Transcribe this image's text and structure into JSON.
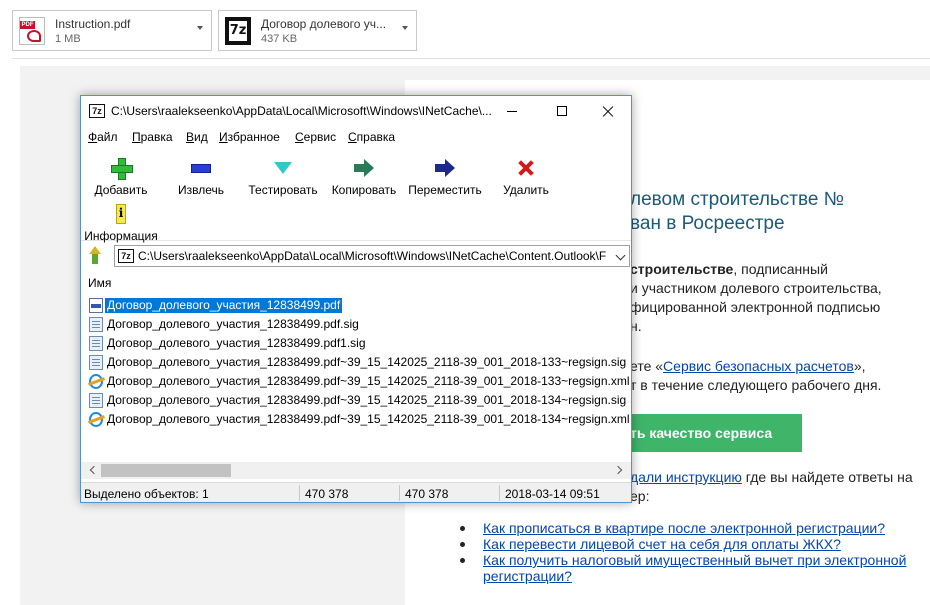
{
  "attachments": [
    {
      "name": "Instruction.pdf",
      "size": "1 MB"
    },
    {
      "name": "Договор долевого уч...",
      "size": "437 KB"
    }
  ],
  "email": {
    "title_line1": "левом строительстве №",
    "title_line2": "ван в Росреестре",
    "para1_bold": "строительстве",
    "para1_line1_rest": ", подписанный",
    "para1_line2": "и участником долевого строительства,",
    "para1_line3": "фицированной электронной подписью",
    "para1_line4": "н.",
    "para2_line1_pre": "ете «",
    "para2_link": "Сервис безопасных расчетов",
    "para2_line1_post": "»,",
    "para2_line2": "т в течение следующего рабочего дня.",
    "button_label": "ть качество сервиса",
    "para3_link": "дали инструкцию",
    "para3_rest": " где вы найдете ответы на",
    "para3_line2": "ер:",
    "list": [
      "Как прописаться в квартире после электронной регистрации?",
      "Как перевести лицевой счет на себя для оплаты ЖКХ?",
      "Как получить налоговый имущественный вычет при электронной",
      "регистрации?"
    ]
  },
  "window": {
    "title": "C:\\Users\\raalekseenko\\AppData\\Local\\Microsoft\\Windows\\INetCache\\...",
    "menu": [
      "Файл",
      "Правка",
      "Вид",
      "Избранное",
      "Сервис",
      "Справка"
    ],
    "toolbar": {
      "add": "Добавить",
      "extract": "Извлечь",
      "test": "Тестировать",
      "copy": "Копировать",
      "move": "Переместить",
      "delete": "Удалить",
      "info": "Информация"
    },
    "address": "C:\\Users\\raalekseenko\\AppData\\Local\\Microsoft\\Windows\\INetCache\\Content.Outlook\\F",
    "column_name": "Имя",
    "files": [
      {
        "name": "Договор_долевого_участия_12838499.pdf",
        "icon": "pdf-file-icon"
      },
      {
        "name": "Договор_долевого_участия_12838499.pdf.sig",
        "icon": "document-icon"
      },
      {
        "name": "Договор_долевого_участия_12838499.pdf1.sig",
        "icon": "document-icon"
      },
      {
        "name": "Договор_долевого_участия_12838499.pdf~39_15_142025_2118-39_001_2018-133~regsign.sig",
        "icon": "document-icon"
      },
      {
        "name": "Договор_долевого_участия_12838499.pdf~39_15_142025_2118-39_001_2018-133~regsign.xml",
        "icon": "ie-file-icon"
      },
      {
        "name": "Договор_долевого_участия_12838499.pdf~39_15_142025_2118-39_001_2018-134~regsign.sig",
        "icon": "document-icon"
      },
      {
        "name": "Договор_долевого_участия_12838499.pdf~39_15_142025_2118-39_001_2018-134~regsign.xml",
        "icon": "ie-file-icon"
      }
    ],
    "status": {
      "selected": "Выделено объектов: 1",
      "size": "470 378",
      "packed": "470 378",
      "modified": "2018-03-14 09:51"
    }
  }
}
